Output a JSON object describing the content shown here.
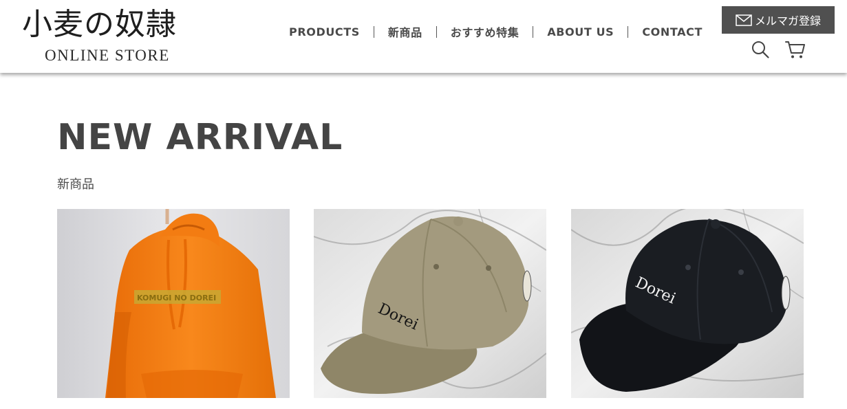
{
  "header": {
    "logo_jp": "小麦の奴隷",
    "logo_en": "ONLINE STORE",
    "nav": [
      "PRODUCTS",
      "新商品",
      "おすすめ特集",
      "ABOUT US",
      "CONTACT"
    ],
    "mail_button": "メルマガ登録",
    "icons": {
      "mail": "mail-icon",
      "search": "search-icon",
      "cart": "cart-icon"
    }
  },
  "main": {
    "title": "NEW ARRIVAL",
    "subtitle": "新商品",
    "products": [
      {
        "image": "orange-hoodie",
        "print": "KOMUGI NO DOREI",
        "color": "#f07a10"
      },
      {
        "image": "khaki-cap",
        "print": "Dorei",
        "color": "#9c9377"
      },
      {
        "image": "black-cap",
        "print": "Dorei",
        "color": "#15181d"
      }
    ]
  },
  "colors": {
    "header_bg": "#ffffff",
    "text": "#4a4a4a",
    "mail_button_bg": "#505050"
  }
}
